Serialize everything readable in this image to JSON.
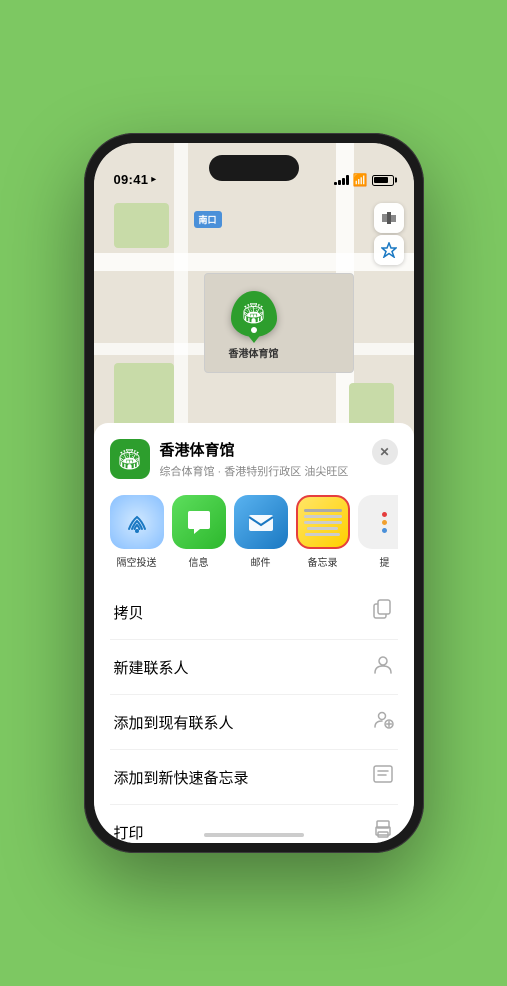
{
  "statusBar": {
    "time": "09:41",
    "locationArrow": "▶"
  },
  "map": {
    "label": "南口"
  },
  "pin": {
    "label": "香港体育馆"
  },
  "venueCard": {
    "title": "香港体育馆",
    "subtitle": "综合体育馆 · 香港特别行政区 油尖旺区",
    "closeLabel": "✕"
  },
  "appIcons": [
    {
      "id": "airdrop",
      "label": "隔空投送",
      "icon": "📡"
    },
    {
      "id": "messages",
      "label": "信息",
      "icon": "💬"
    },
    {
      "id": "mail",
      "label": "邮件",
      "icon": "✉️"
    },
    {
      "id": "notes",
      "label": "备忘录",
      "icon": ""
    },
    {
      "id": "more",
      "label": "提",
      "icon": ""
    }
  ],
  "actions": [
    {
      "label": "拷贝",
      "iconCode": "⎘"
    },
    {
      "label": "新建联系人",
      "iconCode": "👤"
    },
    {
      "label": "添加到现有联系人",
      "iconCode": "➕"
    },
    {
      "label": "添加到新快速备忘录",
      "iconCode": "🗒"
    },
    {
      "label": "打印",
      "iconCode": "🖨"
    }
  ],
  "colors": {
    "green": "#2d9e2d",
    "blue": "#1a78c2",
    "red": "#e53e3e",
    "yellow": "#ffd000",
    "notesBorder": "#e53e3e"
  }
}
